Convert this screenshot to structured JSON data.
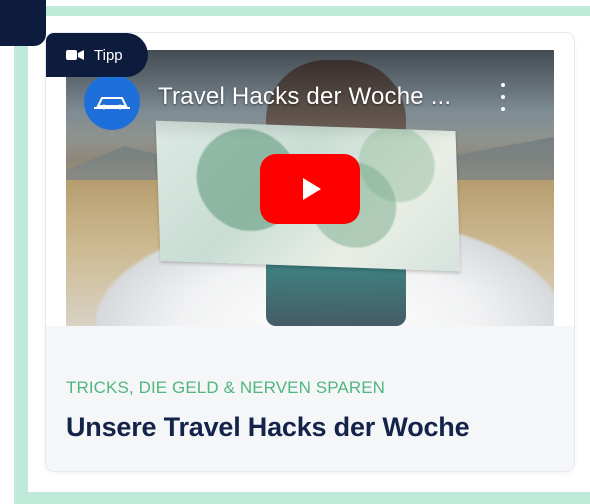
{
  "badge": {
    "label": "Tipp",
    "icon": "video-camera-icon"
  },
  "video": {
    "title": "Travel Hacks der Woche ...",
    "channel_icon": "car-logo-icon",
    "menu_icon": "kebab-menu-icon",
    "play_icon": "youtube-play-icon"
  },
  "article": {
    "kicker": "TRICKS, DIE GELD & NERVEN SPAREN",
    "headline": "Unsere Travel Hacks der Woche"
  },
  "colors": {
    "frame": "#bfe9d9",
    "navy": "#0d1b3d",
    "kicker_green": "#51b67e",
    "headline_navy": "#13234a",
    "play_red": "#ff0000",
    "avatar_blue": "#1e6fd9"
  }
}
